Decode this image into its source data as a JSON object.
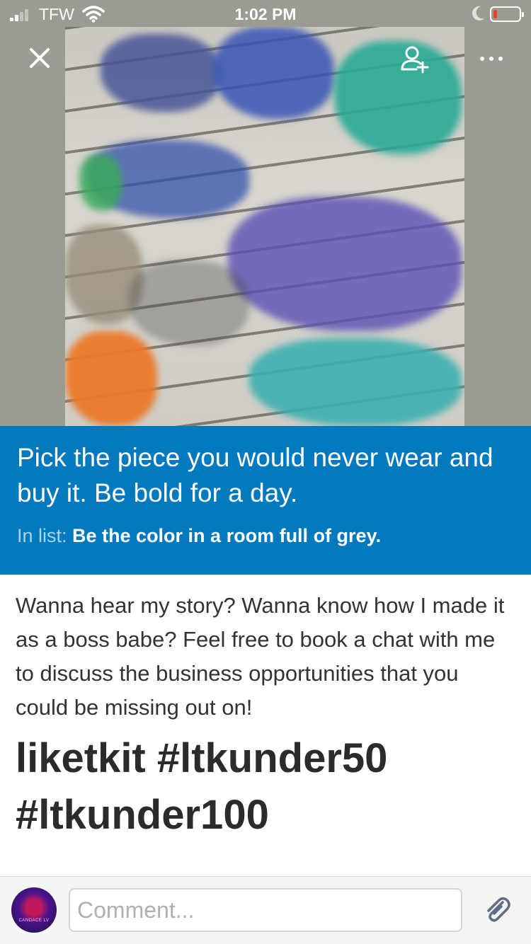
{
  "status_bar": {
    "carrier": "TFW",
    "time": "1:02 PM",
    "signal_bars": 2,
    "battery_level_fraction": 0.1,
    "icons": [
      "signal-icon",
      "wifi-icon",
      "moon-icon",
      "battery-icon"
    ]
  },
  "toolbar": {
    "icons": [
      "close-icon",
      "add-member-icon",
      "more-icon"
    ]
  },
  "card": {
    "title": "Pick the piece you would never wear and buy it. Be bold for a day.",
    "list_prefix": "In list: ",
    "list_name": "Be the color in a room full of grey.",
    "banner_color": "#0079bf",
    "description_text": "Wanna hear my story? Wanna know how I made it as a boss babe? Feel free to book a chat with me to discuss the business opportunities that you could be missing out on!",
    "description_heading": "liketkit #ltkunder50 #ltkunder100"
  },
  "comment_bar": {
    "placeholder": "Comment...",
    "avatar_caption": "CANDACE LV",
    "icons": [
      "avatar",
      "paperclip-icon"
    ]
  }
}
